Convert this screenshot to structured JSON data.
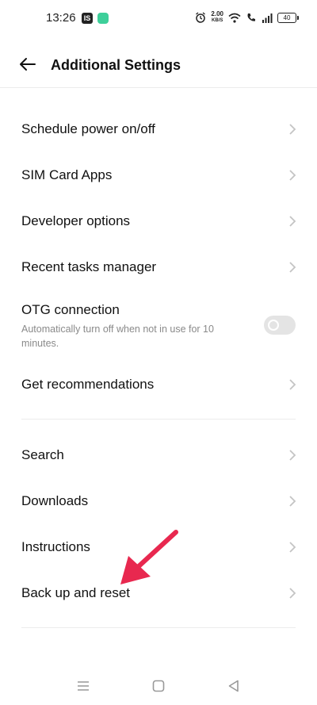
{
  "status_bar": {
    "time": "13:26",
    "notif_badge": "IS",
    "net_speed_value": "2.00",
    "net_speed_unit": "KB/S",
    "battery": "40"
  },
  "header": {
    "title": "Additional Settings"
  },
  "settings": {
    "group1": [
      {
        "label": "Schedule power on/off"
      },
      {
        "label": "SIM Card Apps"
      },
      {
        "label": "Developer options"
      },
      {
        "label": "Recent tasks manager"
      }
    ],
    "otg": {
      "label": "OTG connection",
      "description": "Automatically turn off when not in use for 10 minutes.",
      "enabled": false
    },
    "recommendations": {
      "label": "Get recommendations"
    },
    "group2": [
      {
        "label": "Search"
      },
      {
        "label": "Downloads"
      },
      {
        "label": "Instructions"
      },
      {
        "label": "Back up and reset"
      }
    ]
  },
  "colors": {
    "annotation_arrow": "#e8284f",
    "toggle_off": "#e4e4e4",
    "divider": "#ececec",
    "secondary_text": "#8a8a8a"
  },
  "icons": {
    "back": "back-arrow-icon",
    "chevron": "chevron-right-icon",
    "nav_menu": "menu-icon",
    "nav_home": "home-square-icon",
    "nav_back": "back-triangle-icon"
  }
}
